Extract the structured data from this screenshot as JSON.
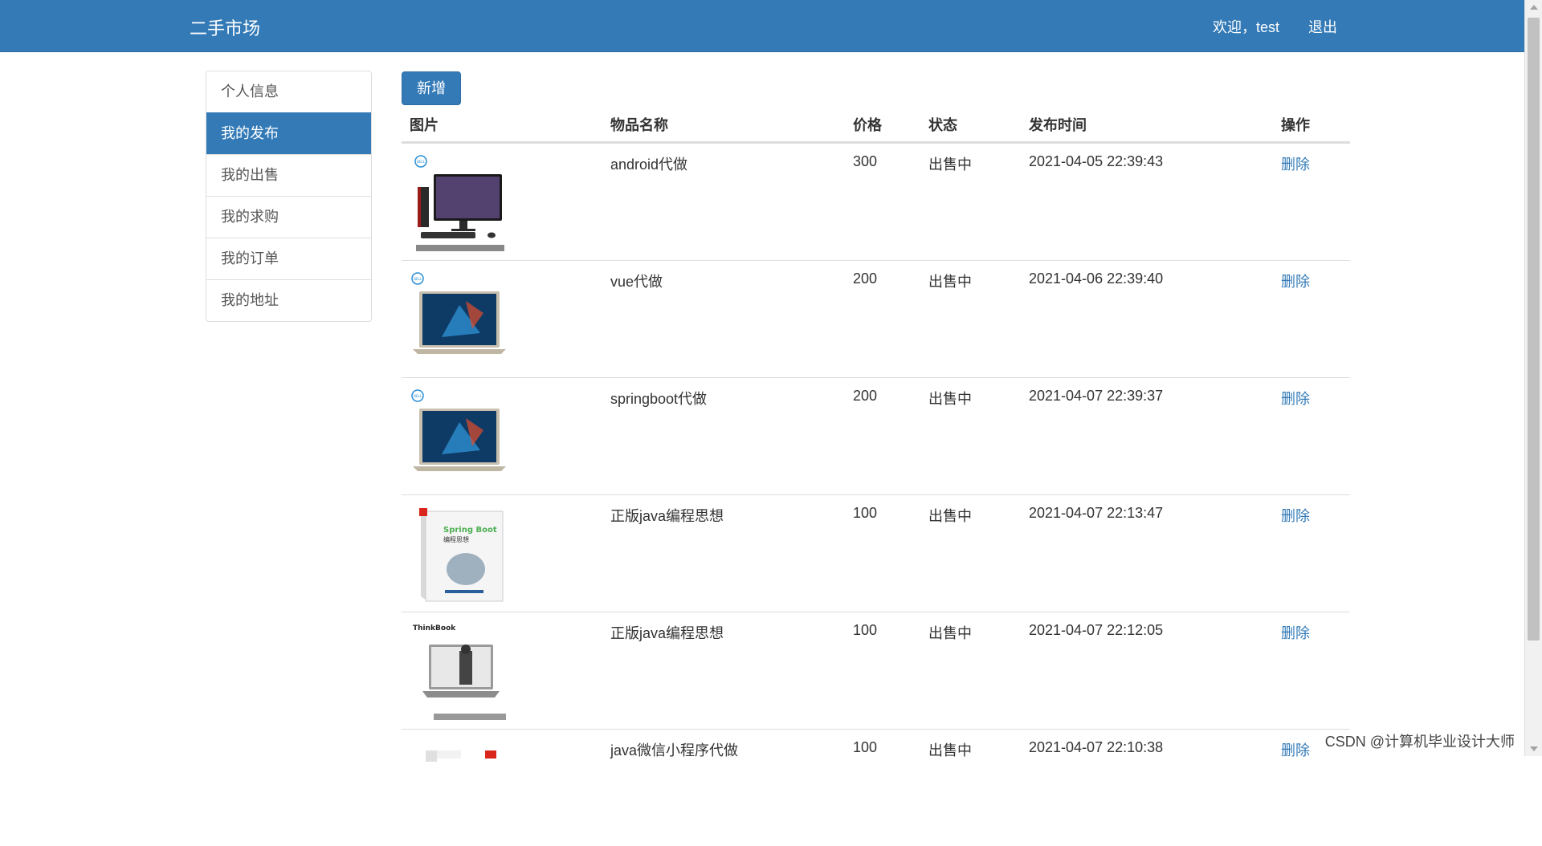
{
  "header": {
    "brand": "二手市场",
    "welcome": "欢迎，test",
    "logout": "退出",
    "bg_color": "#337ab7"
  },
  "sidebar": {
    "items": [
      {
        "label": "个人信息",
        "active": false
      },
      {
        "label": "我的发布",
        "active": true
      },
      {
        "label": "我的出售",
        "active": false
      },
      {
        "label": "我的求购",
        "active": false
      },
      {
        "label": "我的订单",
        "active": false
      },
      {
        "label": "我的地址",
        "active": false
      }
    ]
  },
  "toolbar": {
    "add_label": "新增"
  },
  "table": {
    "headers": {
      "image": "图片",
      "name": "物品名称",
      "price": "价格",
      "status": "状态",
      "time": "发布时间",
      "action": "操作"
    },
    "rows": [
      {
        "image": "desktop-pc",
        "name": "android代做",
        "price": "300",
        "status": "出售中",
        "time": "2021-04-05 22:39:43",
        "action": "删除"
      },
      {
        "image": "laptop",
        "name": "vue代做",
        "price": "200",
        "status": "出售中",
        "time": "2021-04-06 22:39:40",
        "action": "删除"
      },
      {
        "image": "laptop",
        "name": "springboot代做",
        "price": "200",
        "status": "出售中",
        "time": "2021-04-07 22:39:37",
        "action": "删除"
      },
      {
        "image": "book-springboot",
        "name": "正版java编程思想",
        "price": "100",
        "status": "出售中",
        "time": "2021-04-07 22:13:47",
        "action": "删除"
      },
      {
        "image": "thinkbook-laptop",
        "name": "正版java编程思想",
        "price": "100",
        "status": "出售中",
        "time": "2021-04-07 22:12:05",
        "action": "删除"
      },
      {
        "image": "book-cover",
        "name": "java微信小程序代做",
        "price": "100",
        "status": "出售中",
        "time": "2021-04-07 22:10:38",
        "action": "删除"
      }
    ]
  },
  "watermark": "CSDN @计算机毕业设计大师"
}
